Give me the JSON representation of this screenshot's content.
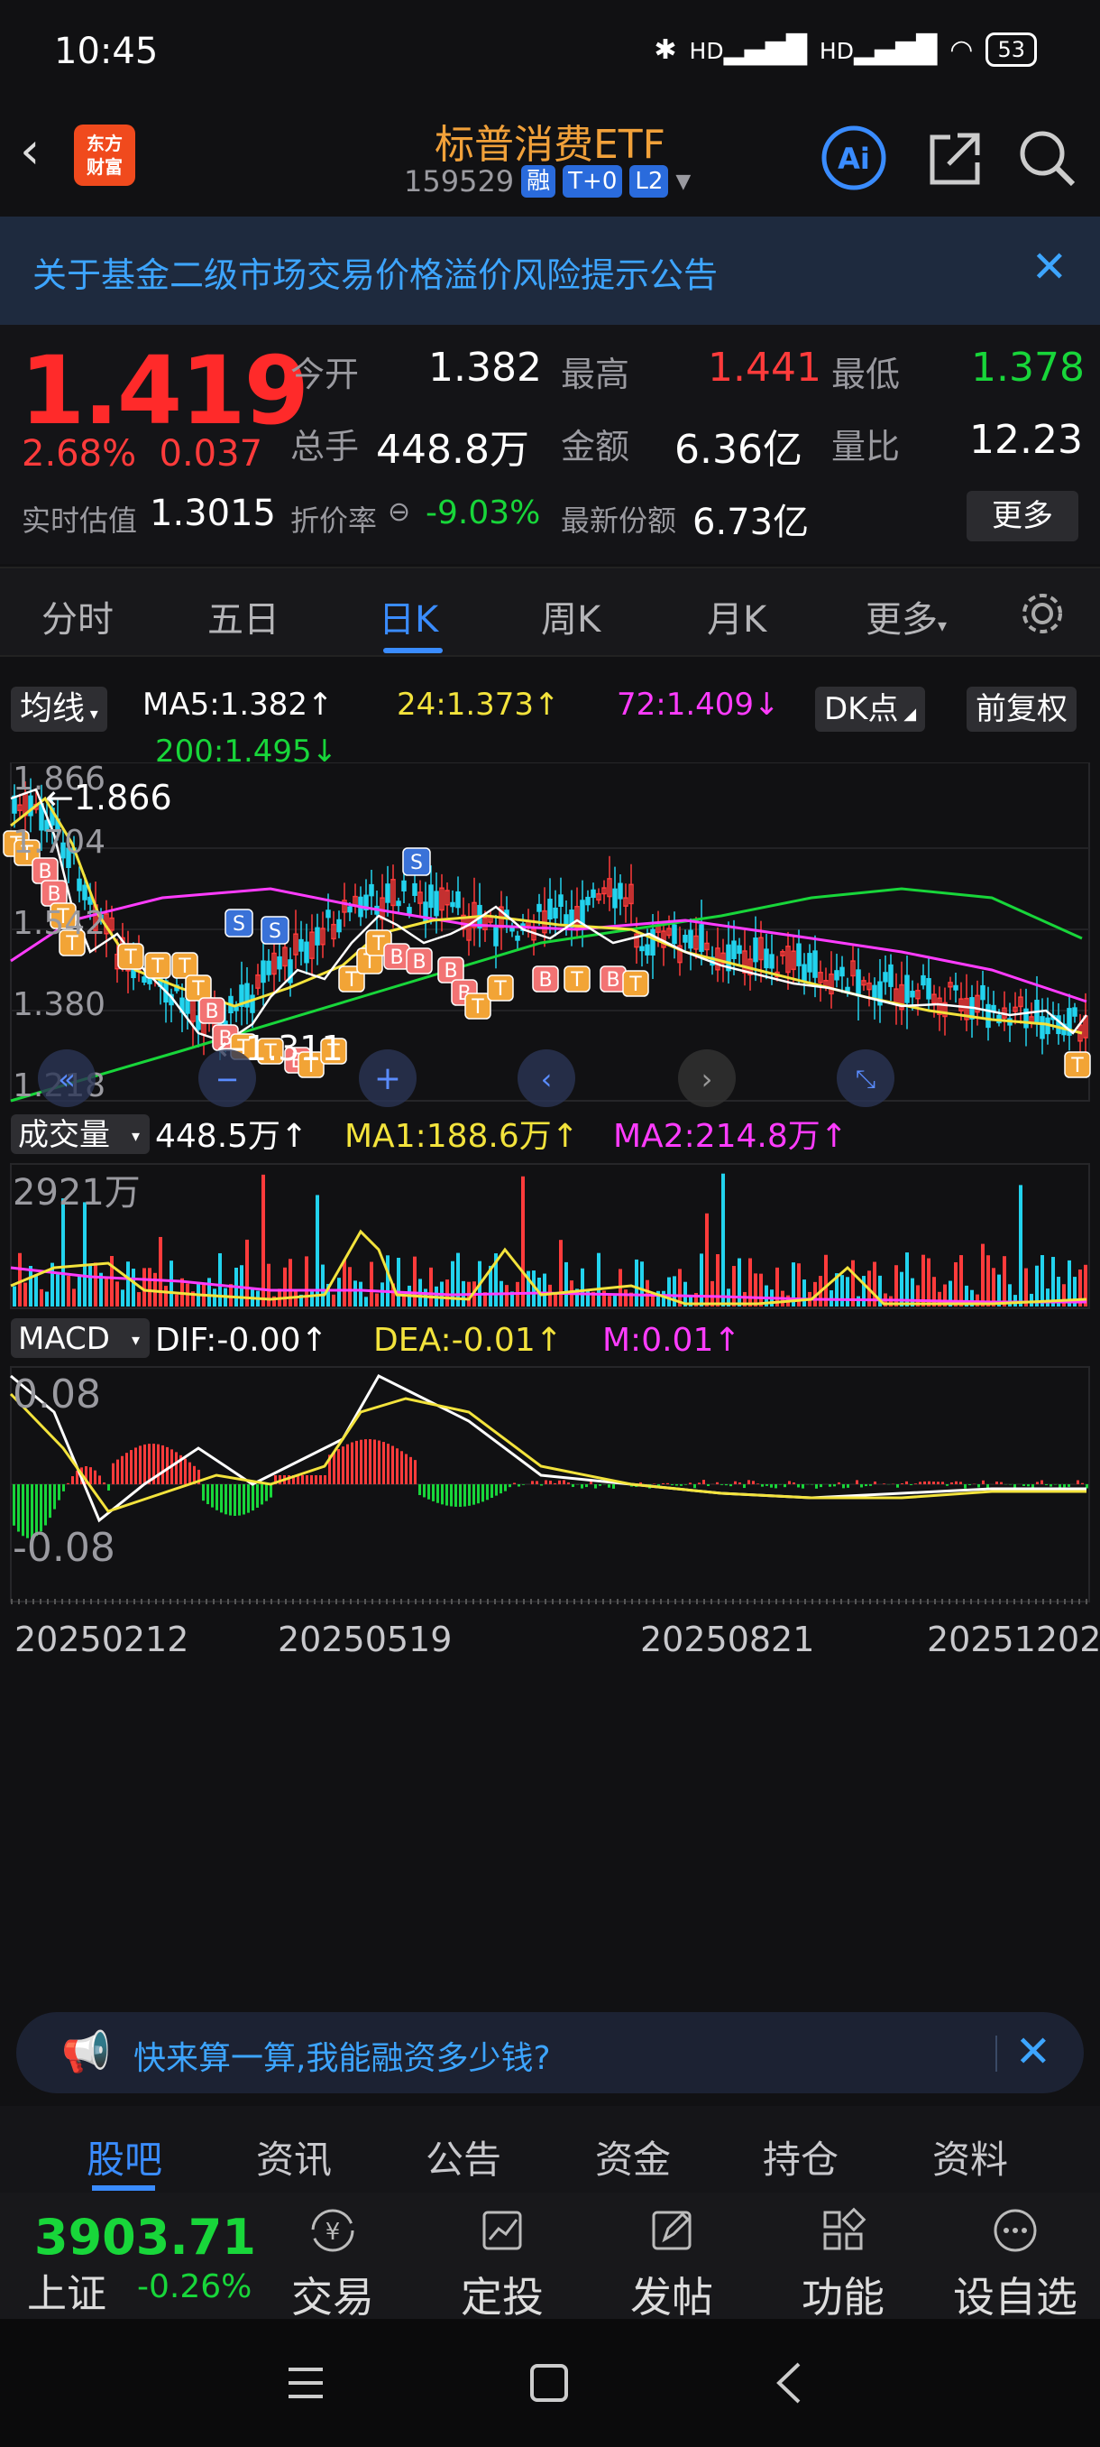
{
  "status": {
    "time": "10:45",
    "battery": "53",
    "signal1": "HD",
    "signal2": "HD"
  },
  "header": {
    "logo_line1": "东方",
    "logo_line2": "财富",
    "title": "标普消费ETF",
    "code": "159529",
    "tag_rong": "融",
    "tag_t0": "T+0",
    "tag_l2": "L2"
  },
  "notice": {
    "text": "关于基金二级市场交易价格溢价风险提示公告"
  },
  "quote": {
    "price": "1.419",
    "change_pct": "2.68%",
    "change": "0.037",
    "open_label": "今开",
    "open": "1.382",
    "high_label": "最高",
    "high": "1.441",
    "low_label": "最低",
    "low": "1.378",
    "volume_label": "总手",
    "volume": "448.8万",
    "amount_label": "金额",
    "amount": "6.36亿",
    "ratio_label": "量比",
    "ratio": "12.23",
    "est_label": "实时估值",
    "est": "1.3015",
    "discount_label": "折价率",
    "discount": "-9.03%",
    "shares_label": "最新份额",
    "shares": "6.73亿",
    "more": "更多"
  },
  "tabs": {
    "t1": "分时",
    "t2": "五日",
    "t3": "日K",
    "t4": "周K",
    "t5": "月K",
    "t6": "更多"
  },
  "chart": {
    "ma_button": "均线",
    "ma5": "MA5:1.382",
    "ma24": "24:1.373",
    "ma72": "72:1.409",
    "ma200": "200:1.495",
    "dk_button": "DK点",
    "adjust_button": "前复权",
    "axis_top": "1.866",
    "axis_2": "1.704",
    "axis_3": "1.542",
    "axis_4": "1.380",
    "axis_bottom": "1.218",
    "max_label": "1.866",
    "min_label": "1.311",
    "vol_button": "成交量",
    "vol_value": "448.5万",
    "vol_ma1": "MA1:188.6万",
    "vol_ma2": "MA2:214.8万",
    "vol_axis": "2921万",
    "macd_button": "MACD",
    "dif": "DIF:-0.00",
    "dea": "DEA:-0.01",
    "m": "M:0.01",
    "macd_top": "0.08",
    "macd_bottom": "-0.08",
    "date1": "20250212",
    "date2": "20250519",
    "date3": "20250821",
    "date4": "20251202"
  },
  "chart_data": {
    "type": "candlestick",
    "title": "",
    "y_range": [
      1.218,
      1.866
    ],
    "x_dates": [
      "20250212",
      "20250519",
      "20250821",
      "20251202"
    ],
    "ma_values": {
      "MA5": 1.382,
      "MA24": 1.373,
      "MA72": 1.409,
      "MA200": 1.495
    },
    "volume": {
      "current": "448.5万",
      "MA1": "188.6万",
      "MA2": "214.8万",
      "max": "2921万"
    },
    "macd": {
      "DIF": -0.0,
      "DEA": -0.01,
      "M": 0.01,
      "range": [
        -0.08,
        0.08
      ]
    },
    "colors": {
      "up": "#ff3b3b",
      "down": "#22d3ee",
      "ma5": "#ffffff",
      "ma24": "#f3e33c",
      "ma72": "#ff3cff",
      "ma200": "#18d63a"
    }
  },
  "ad": {
    "text": "快来算一算,我能融资多少钱?"
  },
  "bottom_tabs": {
    "b1": "股吧",
    "b2": "资讯",
    "b3": "公告",
    "b4": "资金",
    "b5": "持仓",
    "b6": "资料"
  },
  "actions": {
    "index_value": "3903.71",
    "index_name": "上证",
    "index_change": "-0.26%",
    "a1": "交易",
    "a2": "定投",
    "a3": "发帖",
    "a4": "功能",
    "a5": "设自选"
  }
}
